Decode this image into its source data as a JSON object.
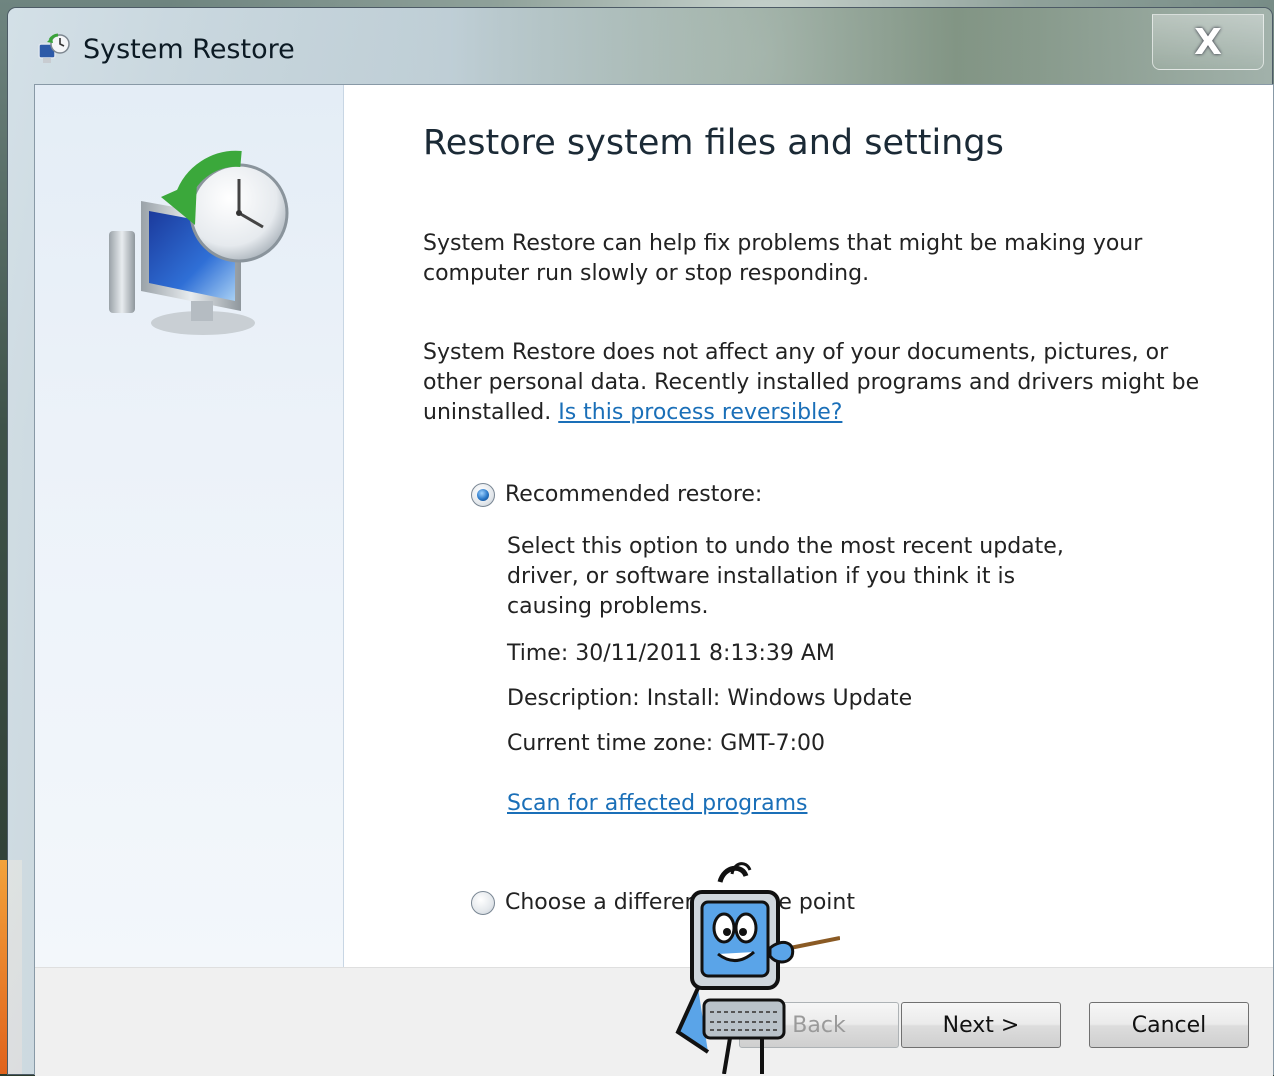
{
  "window": {
    "title": "System Restore",
    "close_glyph": "X"
  },
  "main": {
    "heading": "Restore system files and settings",
    "para1": "System Restore can help fix problems that might be making your computer run slowly or stop responding.",
    "para2_text": "System Restore does not affect any of your documents, pictures, or other personal data. Recently installed programs and drivers might be uninstalled.",
    "para2_link": "Is this process reversible?"
  },
  "options": {
    "recommended": {
      "label": "Recommended restore:",
      "selected": true,
      "description": "Select this option to undo the most recent update, driver, or software installation if you think it is causing problems.",
      "time": "Time: 30/11/2011 8:13:39 AM",
      "desc_line": "Description: Install: Windows Update",
      "timezone": "Current time zone: GMT-7:00",
      "scan_link": "Scan for affected programs"
    },
    "different": {
      "label": "Choose a different restore point",
      "selected": false
    }
  },
  "buttons": {
    "back": "Back",
    "next": "Next >",
    "cancel": "Cancel"
  },
  "icons": {
    "title": "system-restore-icon",
    "hero": "restore-computer-clock-icon",
    "mascot": "computer-mascot-pointer"
  },
  "colors": {
    "link": "#1a6fb8",
    "radio_selected": "#2a78c8"
  }
}
